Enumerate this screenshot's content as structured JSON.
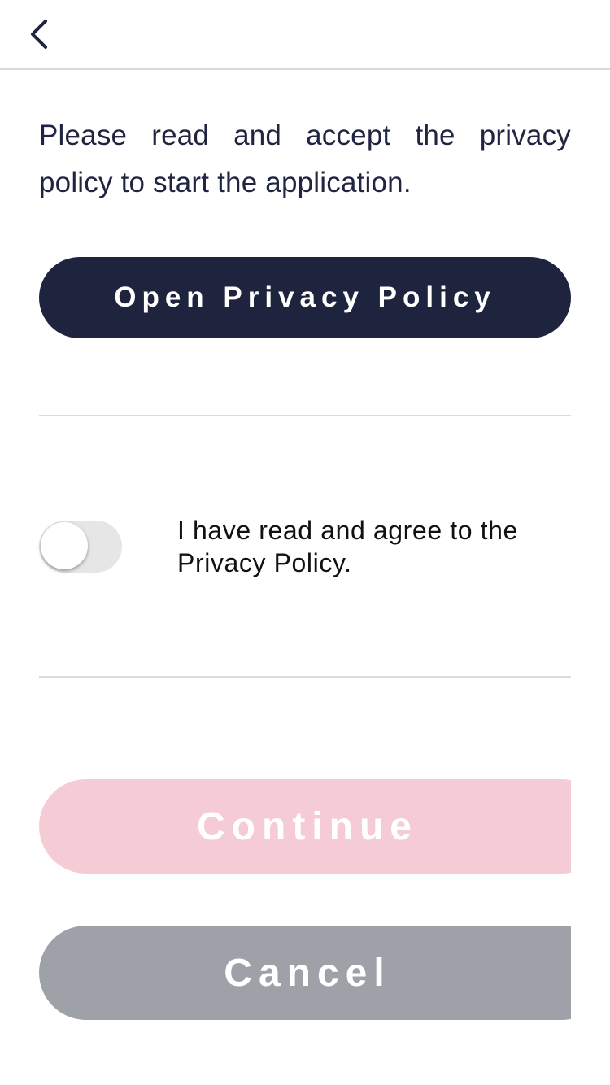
{
  "header": {
    "back_icon": "chevron-left-icon"
  },
  "intro": {
    "text": "Please read and accept the privacy policy to start the application."
  },
  "buttons": {
    "open_privacy_policy": "Open Privacy Policy",
    "continue": "Continue",
    "cancel": "Cancel"
  },
  "agreement": {
    "toggle_on": false,
    "label": "I have read and agree to the Privacy Policy."
  },
  "colors": {
    "primary_dark": "#1e233e",
    "continue_disabled": "#f5ccd5",
    "cancel_gray": "#9ea1a8",
    "text_dark": "#1f2540"
  }
}
